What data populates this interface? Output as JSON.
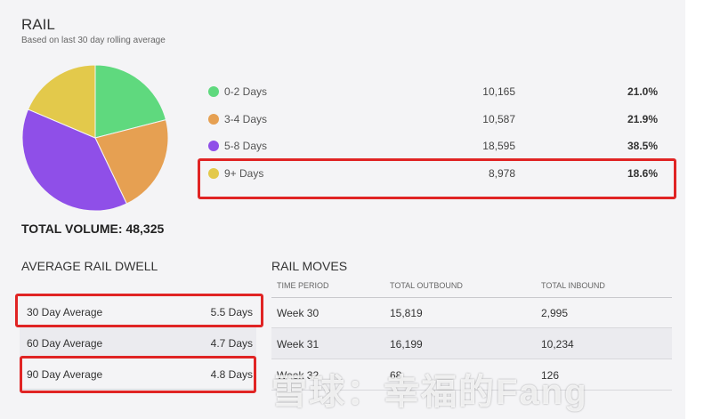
{
  "header": {
    "title": "RAIL",
    "subtitle": "Based on last 30 day rolling average"
  },
  "volume": {
    "total_label": "TOTAL VOLUME: 48,325",
    "segments": [
      {
        "label": "0-2 Days",
        "count": "10,165",
        "percent": "21.0%",
        "value": 21.0,
        "color": "#5fd97e"
      },
      {
        "label": "3-4 Days",
        "count": "10,587",
        "percent": "21.9%",
        "value": 21.9,
        "color": "#e6a052"
      },
      {
        "label": "5-8 Days",
        "count": "18,595",
        "percent": "38.5%",
        "value": 38.5,
        "color": "#8f4fe8"
      },
      {
        "label": "9+ Days",
        "count": "8,978",
        "percent": "18.6%",
        "value": 18.6,
        "color": "#e3c94b"
      }
    ]
  },
  "dwell": {
    "heading": "AVERAGE RAIL DWELL",
    "rows": [
      {
        "name": "30 Day Average",
        "days": "5.5 Days"
      },
      {
        "name": "60 Day Average",
        "days": "4.7 Days"
      },
      {
        "name": "90 Day Average",
        "days": "4.8 Days"
      }
    ]
  },
  "moves": {
    "heading": "RAIL MOVES",
    "columns": [
      "TIME PERIOD",
      "TOTAL OUTBOUND",
      "TOTAL INBOUND"
    ],
    "rows": [
      [
        "Week 30",
        "15,819",
        "2,995"
      ],
      [
        "Week 31",
        "16,199",
        "10,234"
      ],
      [
        "Week 32",
        "68",
        "126"
      ]
    ]
  },
  "watermark": "雪球：幸福的Fang"
}
